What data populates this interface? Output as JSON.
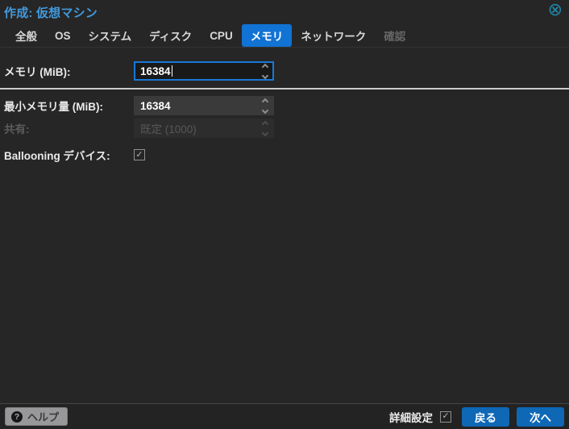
{
  "window": {
    "title": "作成: 仮想マシン"
  },
  "icons": {
    "close": "⊗",
    "help": "?",
    "check": "✓"
  },
  "tabbar": {
    "tabs": [
      {
        "label": "全般"
      },
      {
        "label": "OS"
      },
      {
        "label": "システム"
      },
      {
        "label": "ディスク"
      },
      {
        "label": "CPU"
      },
      {
        "label": "メモリ",
        "active": true
      },
      {
        "label": "ネットワーク"
      },
      {
        "label": "確認",
        "disabled": true
      }
    ]
  },
  "form": {
    "memory": {
      "label": "メモリ (MiB):",
      "value": "16384"
    },
    "min_memory": {
      "label": "最小メモリ量 (MiB):",
      "value": "16384"
    },
    "shares": {
      "label": "共有:",
      "value": "既定 (1000)",
      "disabled": true
    },
    "ballooning": {
      "label": "Ballooning デバイス:",
      "checked": true
    }
  },
  "footer": {
    "help": "ヘルプ",
    "advanced": "詳細設定",
    "advanced_checked": true,
    "back": "戻る",
    "next": "次へ"
  },
  "colors": {
    "background": "#262626",
    "title_text": "#429add",
    "close_icon": "#1e87a8",
    "active_tab": "#1173d4",
    "focus_border": "#1878d8",
    "primary_button": "#0e68b6",
    "separator": "#c9c9c9"
  }
}
